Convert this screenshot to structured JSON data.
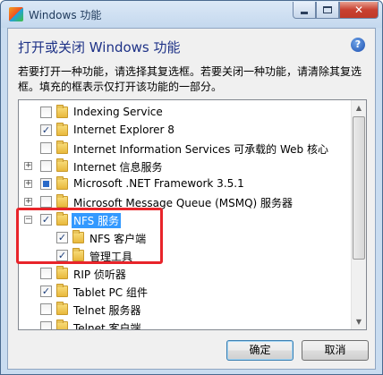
{
  "window": {
    "title": "Windows 功能",
    "heading": "打开或关闭 Windows 功能",
    "help_icon": "?",
    "description": "若要打开一种功能，请选择其复选框。若要关闭一种功能，请清除其复选框。填充的框表示仅打开该功能的一部分。",
    "close_glyph": "✕"
  },
  "features": [
    {
      "label": "Indexing Service",
      "expander": "",
      "state": ""
    },
    {
      "label": "Internet Explorer 8",
      "expander": "",
      "state": "✓"
    },
    {
      "label": "Internet Information Services 可承载的 Web 核心",
      "expander": "",
      "state": ""
    },
    {
      "label": "Internet 信息服务",
      "expander": "+",
      "state": ""
    },
    {
      "label": "Microsoft .NET Framework 3.5.1",
      "expander": "+",
      "state": "partial"
    },
    {
      "label": "Microsoft Message Queue (MSMQ) 服务器",
      "expander": "+",
      "state": ""
    },
    {
      "label": "NFS 服务",
      "expander": "−",
      "state": "✓",
      "selected": true
    },
    {
      "label": "NFS 客户端",
      "expander": "",
      "state": "✓",
      "child": true
    },
    {
      "label": "管理工具",
      "expander": "",
      "state": "✓",
      "child": true
    },
    {
      "label": "RIP 侦听器",
      "expander": "",
      "state": ""
    },
    {
      "label": "Tablet PC 组件",
      "expander": "",
      "state": "✓"
    },
    {
      "label": "Telnet 服务器",
      "expander": "",
      "state": ""
    },
    {
      "label": "Telnet 客户端",
      "expander": "",
      "state": ""
    }
  ],
  "buttons": {
    "ok": "确定",
    "cancel": "取消"
  },
  "colors": {
    "selection": "#3399ff",
    "annotation": "#e8242a",
    "heading": "#1e3287"
  }
}
